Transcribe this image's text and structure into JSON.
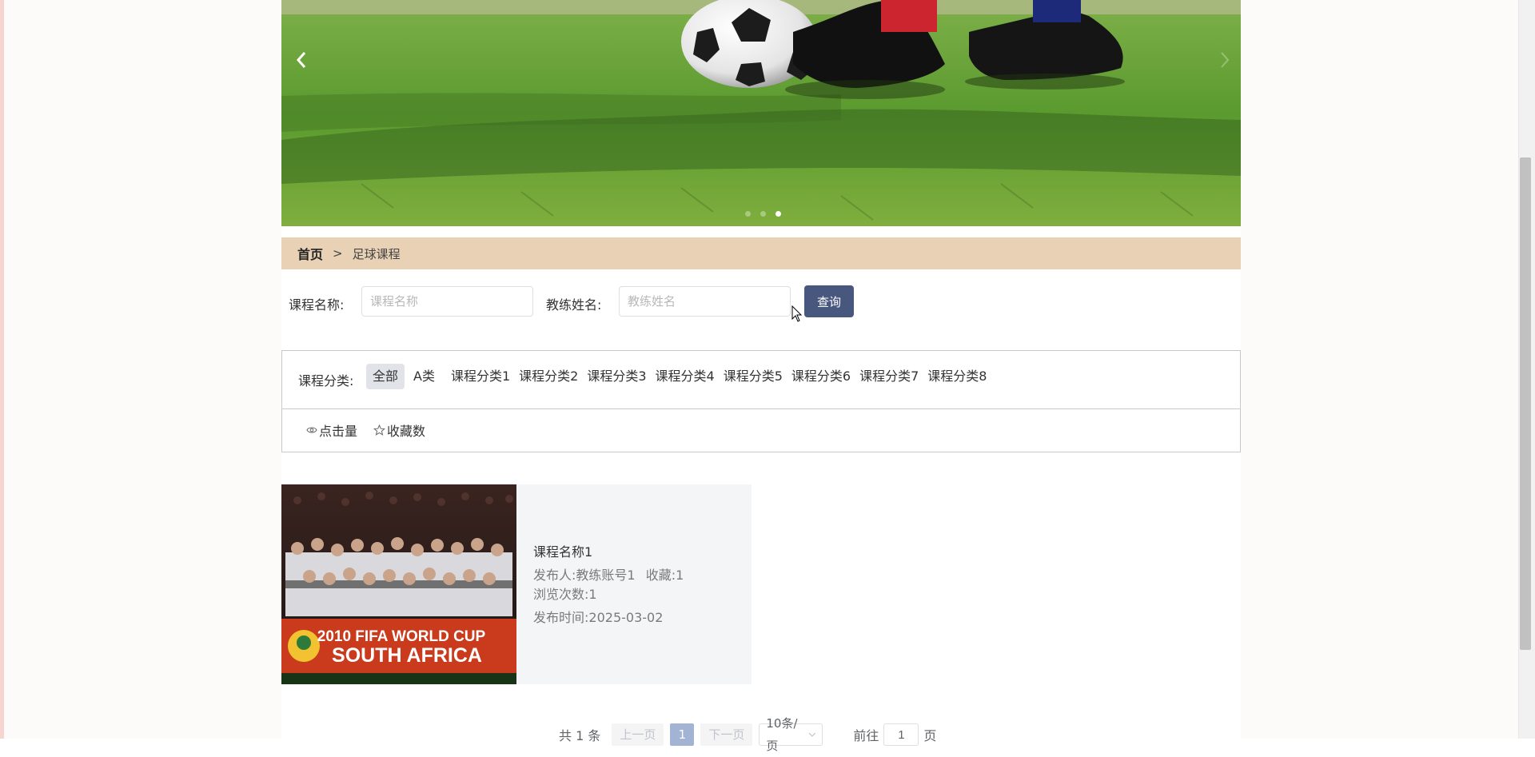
{
  "carousel": {
    "prev_icon": "chevron-left-icon",
    "next_icon": "chevron-right-icon",
    "dot_count": 3,
    "active_dot": 3
  },
  "breadcrumb": {
    "home": "首页",
    "separator": ">",
    "current": "足球课程"
  },
  "search": {
    "course_label": "课程名称:",
    "course_placeholder": "课程名称",
    "coach_label": "教练姓名:",
    "coach_placeholder": "教练姓名",
    "button": "查询"
  },
  "filter": {
    "label": "课程分类:",
    "categories": [
      "全部",
      "A类",
      "课程分类1",
      "课程分类2",
      "课程分类3",
      "课程分类4",
      "课程分类5",
      "课程分类6",
      "课程分类7",
      "课程分类8"
    ],
    "selected": "全部",
    "sort": [
      {
        "icon": "eye-icon",
        "label": "点击量"
      },
      {
        "icon": "star-icon",
        "label": "收藏数"
      }
    ]
  },
  "course": {
    "image_banner_line1": "2010 FIFA WORLD CUP",
    "image_banner_line2": "SOUTH AFRICA",
    "title": "课程名称1",
    "publisher_label": "发布人:",
    "publisher": "教练账号1",
    "favorites_label": "收藏:",
    "favorites": "1",
    "views_label": "浏览次数:",
    "views": "1",
    "time_label": "发布时间:",
    "time": "2025-03-02"
  },
  "pagination": {
    "total": "共 1 条",
    "prev": "上一页",
    "current_page": "1",
    "next": "下一页",
    "page_size": "10条/页",
    "goto_label": "前往",
    "goto_value": "1",
    "page_suffix": "页"
  },
  "colors": {
    "breadcrumb_bg": "#e8d1b4",
    "search_button": "#47577e",
    "active_category_bg": "#e1e3e8",
    "active_page": "#a3b3d4"
  }
}
